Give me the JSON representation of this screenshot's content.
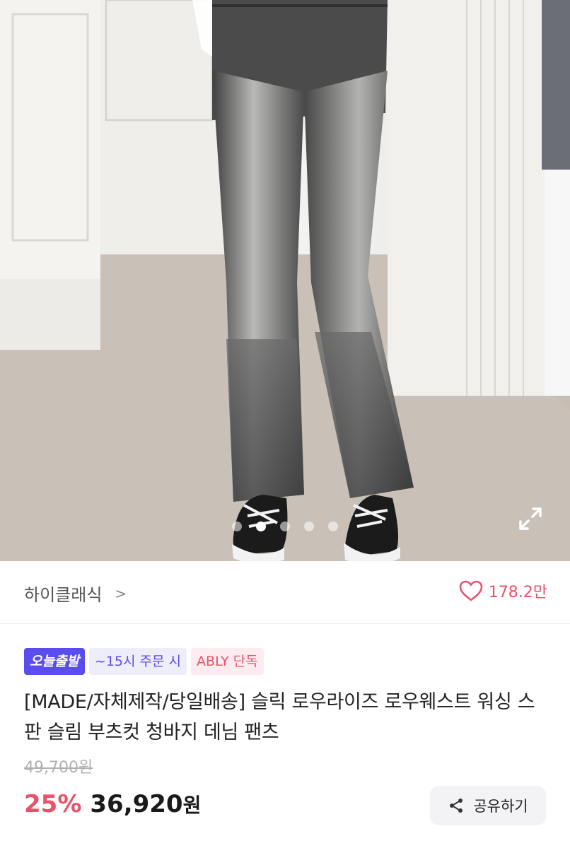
{
  "gallery": {
    "image_alt": "Gray washed bootcut denim jeans with black and white sneakers",
    "page_count": 5,
    "active_page": 2
  },
  "seller": {
    "name": "하이클래식",
    "chevron": ">",
    "likes": "178.2만"
  },
  "badges": {
    "today": "오늘출발",
    "time": "~15시 주문 시",
    "ably": "ABLY 단독"
  },
  "product": {
    "title": "[MADE/자체제작/당일배송] 슬릭 로우라이즈 로우웨스트 워싱 스판 슬림 부츠컷 청바지 데님 팬츠",
    "original_price": "49,700원",
    "discount": "25%",
    "price": "36,920",
    "currency": "원"
  },
  "actions": {
    "share_label": "공유하기"
  },
  "colors": {
    "accent_pink": "#e8536b",
    "accent_purple": "#5b4cf0"
  }
}
